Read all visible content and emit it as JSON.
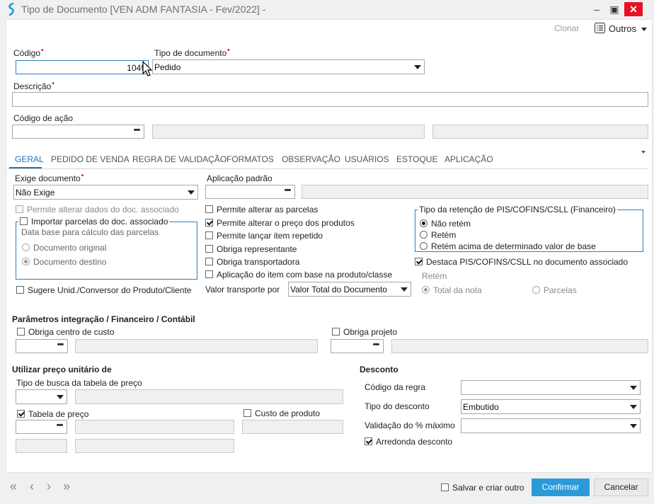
{
  "window": {
    "title": "Tipo de Documento [VEN ADM FANTASIA - Fev/2022]  -",
    "minimize": "–",
    "maximize": "▣",
    "close": "✕"
  },
  "toolbar": {
    "clonar": "Clonar",
    "outros": "Outros"
  },
  "header": {
    "codigo_label": "Código",
    "codigo_value": "1049",
    "tipo_label": "Tipo de documento",
    "tipo_value": "Pedido",
    "descricao_label": "Descrição",
    "descricao_value": "",
    "codigo_acao_label": "Código de ação",
    "codigo_acao_value": ""
  },
  "tabs": [
    "GERAL",
    "PEDIDO DE VENDA",
    "REGRA DE VALIDAÇÃO",
    "FORMATOS",
    "OBSERVAÇÃO",
    "USUÁRIOS",
    "ESTOQUE",
    "APLICAÇÃO"
  ],
  "geral": {
    "exige_label": "Exige documento",
    "exige_value": "Não Exige",
    "aplicacao_label": "Aplicação padrão",
    "permite_alterar_dados": "Permite alterar dados do doc. associado",
    "importar_parcelas": "Importar parcelas do doc. associado",
    "data_base_label": "Data base para cálculo das parcelas",
    "doc_original": "Documento original",
    "doc_destino": "Documento destino",
    "sugere_unid": "Sugere Unid./Conversor do Produto/Cliente",
    "permite_parcelas": "Permite alterar as parcelas",
    "permite_preco": "Permite alterar o preço dos produtos",
    "permite_item_repetido": "Permite lançar item repetido",
    "obriga_representante": "Obriga representante",
    "obriga_transportadora": "Obriga transportadora",
    "aplicacao_item": "Aplicação do item com base na produto/classe",
    "valor_transporte_label": "Valor transporte por",
    "valor_transporte_value": "Valor Total do Documento",
    "retencao_title": "Tipo da retenção de PIS/COFINS/CSLL (Financeiro)",
    "nao_retem": "Não retém",
    "retem": "Retém",
    "retem_acima": "Retém acima de determinado valor de base",
    "destaca": "Destaca PIS/COFINS/CSLL no documento associado",
    "retem_label": "Retém",
    "total_nota": "Total da nota",
    "parcelas": "Parcelas"
  },
  "integracao": {
    "title": "Parâmetros integração / Financeiro / Contábil",
    "obriga_centro": "Obriga centro de custo",
    "obriga_projeto": "Obriga projeto"
  },
  "preco": {
    "title": "Utilizar preço unitário de",
    "tipo_busca_label": "Tipo de busca da tabela de preço",
    "tabela_preco": "Tabela de preço",
    "custo_produto": "Custo de produto"
  },
  "desconto": {
    "title": "Desconto",
    "codigo_regra_label": "Código da regra",
    "tipo_label": "Tipo do desconto",
    "tipo_value": "Embutido",
    "validacao_label": "Validação do % máximo",
    "arredonda": "Arredonda desconto"
  },
  "footer": {
    "salvar_criar": "Salvar e criar outro",
    "confirmar": "Confirmar",
    "cancelar": "Cancelar",
    "nav_first": "«",
    "nav_prev": "‹",
    "nav_next": "›",
    "nav_last": "»"
  },
  "colors": {
    "accent": "#2b9bd8",
    "tab_active": "#1e73be",
    "required": "#d0021b",
    "close": "#e81123"
  }
}
